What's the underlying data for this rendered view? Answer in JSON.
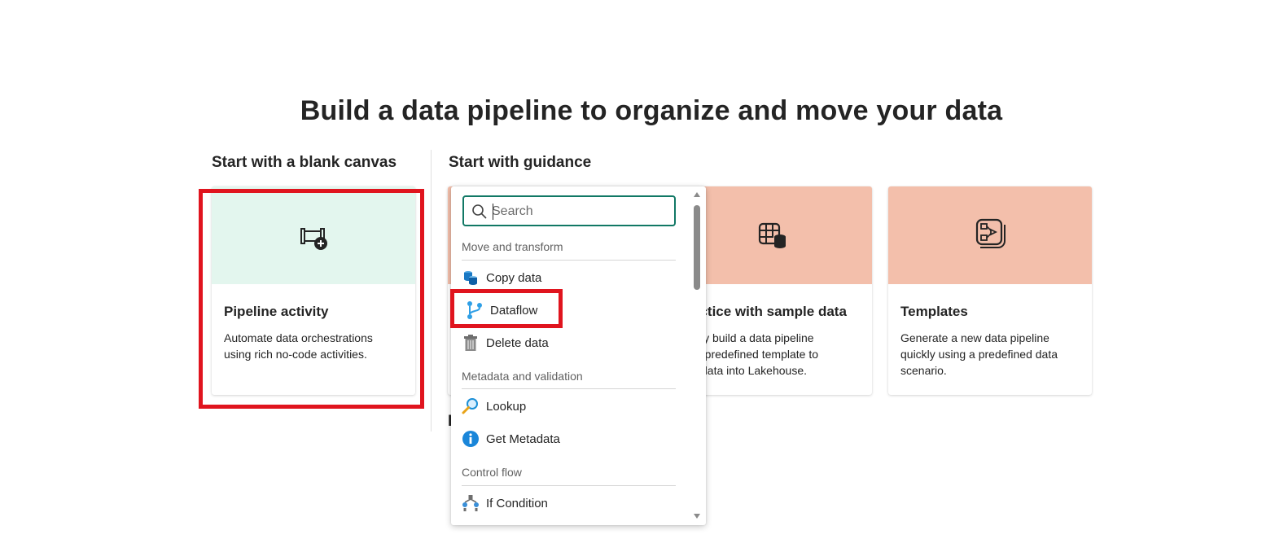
{
  "page": {
    "title": "Build a data pipeline to organize and move your data"
  },
  "sections": {
    "blank_canvas": "Start with a blank canvas",
    "guidance": "Start with guidance"
  },
  "cards": {
    "pipeline_activity": {
      "title": "Pipeline activity",
      "desc_line1": "Automate data orchestrations",
      "desc_line2": "using rich no-code activities.",
      "icon": "pipeline-add-icon"
    },
    "sample_data": {
      "title": "actice with sample data",
      "desc_line1": "kly build a data pipeline",
      "desc_line2": "a predefined template to",
      "desc_line3": "data into Lakehouse.",
      "icon": "table-database-icon"
    },
    "templates": {
      "title": "Templates",
      "desc_line1": "Generate a new data pipeline",
      "desc_line2": "quickly using a predefined data",
      "desc_line3": "scenario.",
      "icon": "template-flow-icon"
    },
    "hidden_letter": "I"
  },
  "dropdown": {
    "search": {
      "placeholder": "Search",
      "value": ""
    },
    "groups": [
      {
        "label": "Move and transform",
        "items": [
          {
            "label": "Copy data",
            "icon": "copy-data-icon"
          },
          {
            "label": "Dataflow",
            "icon": "dataflow-icon"
          },
          {
            "label": "Delete data",
            "icon": "trash-icon"
          }
        ]
      },
      {
        "label": "Metadata and validation",
        "items": [
          {
            "label": "Lookup",
            "icon": "lookup-icon"
          },
          {
            "label": "Get Metadata",
            "icon": "info-icon"
          }
        ]
      },
      {
        "label": "Control flow",
        "items": [
          {
            "label": "If Condition",
            "icon": "if-condition-icon"
          }
        ]
      }
    ]
  },
  "colors": {
    "accent": "#117865",
    "highlight": "#e0141e",
    "mint_banner": "#e3f6ee",
    "salmon_banner": "#f3bfab"
  }
}
